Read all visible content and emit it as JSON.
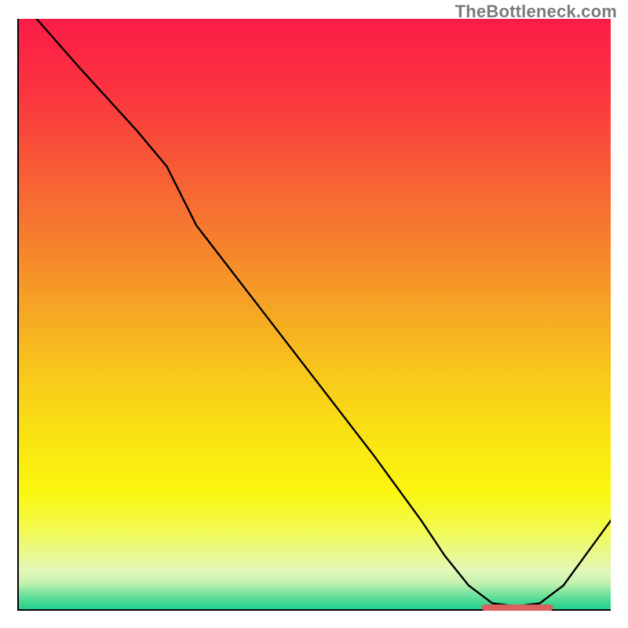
{
  "watermark": "TheBottleneck.com",
  "colors": {
    "gradient_stops": [
      {
        "offset": 0.0,
        "color": "#fc1c47"
      },
      {
        "offset": 0.12,
        "color": "#fb3340"
      },
      {
        "offset": 0.25,
        "color": "#f85a36"
      },
      {
        "offset": 0.38,
        "color": "#f6812d"
      },
      {
        "offset": 0.5,
        "color": "#f6a823"
      },
      {
        "offset": 0.62,
        "color": "#f8cd19"
      },
      {
        "offset": 0.72,
        "color": "#f9e611"
      },
      {
        "offset": 0.8,
        "color": "#fbf60f"
      },
      {
        "offset": 0.86,
        "color": "#f3fa4a"
      },
      {
        "offset": 0.9,
        "color": "#eaf985"
      },
      {
        "offset": 0.935,
        "color": "#e1f8b9"
      },
      {
        "offset": 0.955,
        "color": "#c7f1b0"
      },
      {
        "offset": 0.97,
        "color": "#89e6a3"
      },
      {
        "offset": 0.985,
        "color": "#4edb96"
      },
      {
        "offset": 1.0,
        "color": "#21d18c"
      }
    ],
    "curve": "#000000",
    "marker": "#d9625f",
    "axis": "#000000"
  },
  "chart_data": {
    "type": "line",
    "title": "",
    "xlabel": "",
    "ylabel": "",
    "xlim": [
      0,
      100
    ],
    "ylim": [
      0,
      100
    ],
    "grid": false,
    "legend": false,
    "series": [
      {
        "name": "bottleneck-curve",
        "x": [
          3,
          10,
          20,
          25,
          30,
          40,
          50,
          60,
          68,
          72,
          76,
          80,
          84,
          88,
          92,
          100
        ],
        "y": [
          100,
          92,
          81,
          75,
          65,
          52,
          39,
          26,
          15,
          9,
          4,
          1,
          0.5,
          1,
          4,
          15
        ]
      }
    ],
    "annotations": [
      {
        "name": "optimal-band",
        "x_start": 78,
        "x_end": 90,
        "y": 0.5
      }
    ]
  }
}
